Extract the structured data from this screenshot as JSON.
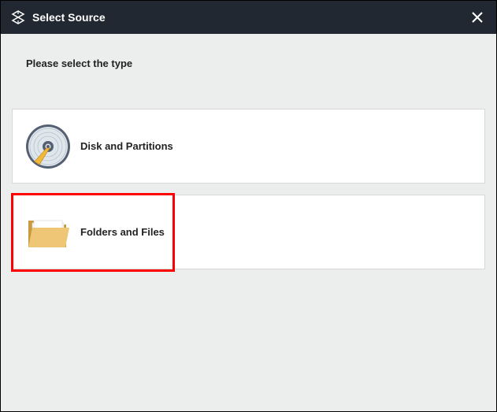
{
  "titlebar": {
    "title": "Select Source"
  },
  "content": {
    "instruction": "Please select the type",
    "options": [
      {
        "label": "Disk and Partitions"
      },
      {
        "label": "Folders and Files"
      }
    ]
  }
}
